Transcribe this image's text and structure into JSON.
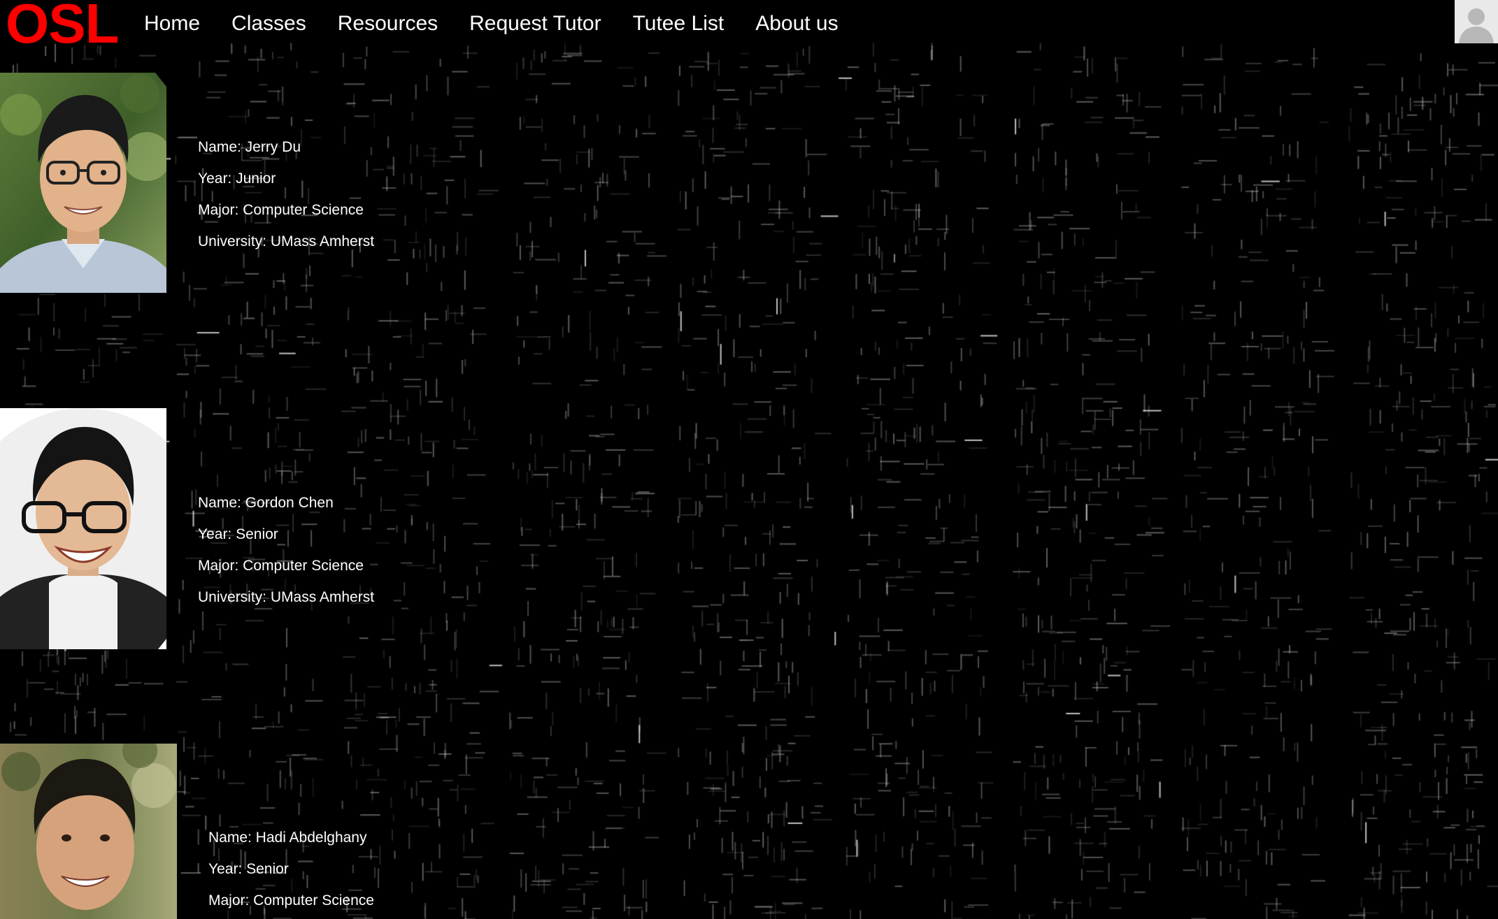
{
  "brand": {
    "logo_text": "OSL",
    "logo_color": "#ff0000"
  },
  "nav": {
    "items": [
      "Home",
      "Classes",
      "Resources",
      "Request Tutor",
      "Tutee List",
      "About us"
    ]
  },
  "user": {
    "avatar_icon": "user-avatar-icon"
  },
  "tutors": [
    {
      "name_label": "Name: Jerry Du",
      "year_label": "Year: Junior",
      "major_label": "Major: Computer Science",
      "university_label": "University: UMass Amherst"
    },
    {
      "name_label": "Name: Gordon Chen",
      "year_label": "Year: Senior",
      "major_label": "Major: Computer Science",
      "university_label": "University: UMass Amherst"
    },
    {
      "name_label": "Name: Hadi Abdelghany",
      "year_label": "Year: Senior",
      "major_label": "Major: Computer Science"
    }
  ],
  "colors": {
    "background": "#000000",
    "text": "#ffffff"
  }
}
